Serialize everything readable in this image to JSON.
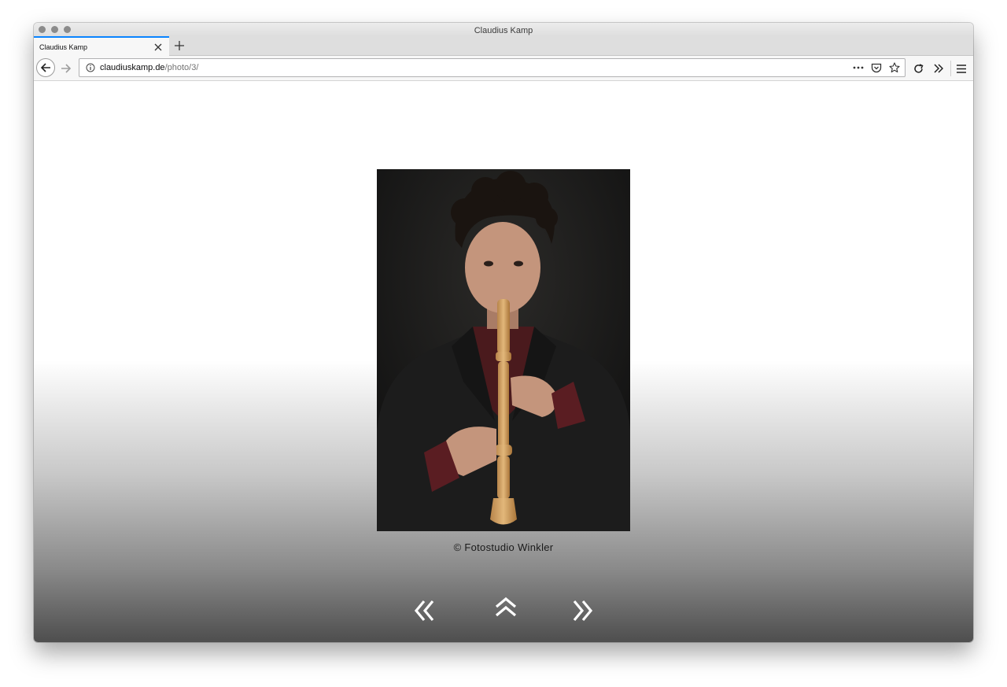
{
  "window": {
    "title": "Claudius Kamp"
  },
  "tabs": [
    {
      "label": "Claudius Kamp",
      "active": true
    }
  ],
  "urlbar": {
    "domain": "claudiuskamp.de",
    "path": "/photo/3/"
  },
  "page": {
    "photo": {
      "subject": "recorder-player-portrait"
    },
    "credit": "© Fotostudio Winkler",
    "navigation": {
      "prev": "previous-photo",
      "up": "back-to-gallery",
      "next": "next-photo"
    }
  },
  "colors": {
    "accent": "#0a84ff",
    "photo_background": "#1b1a19",
    "recorder": "#d2a466"
  }
}
